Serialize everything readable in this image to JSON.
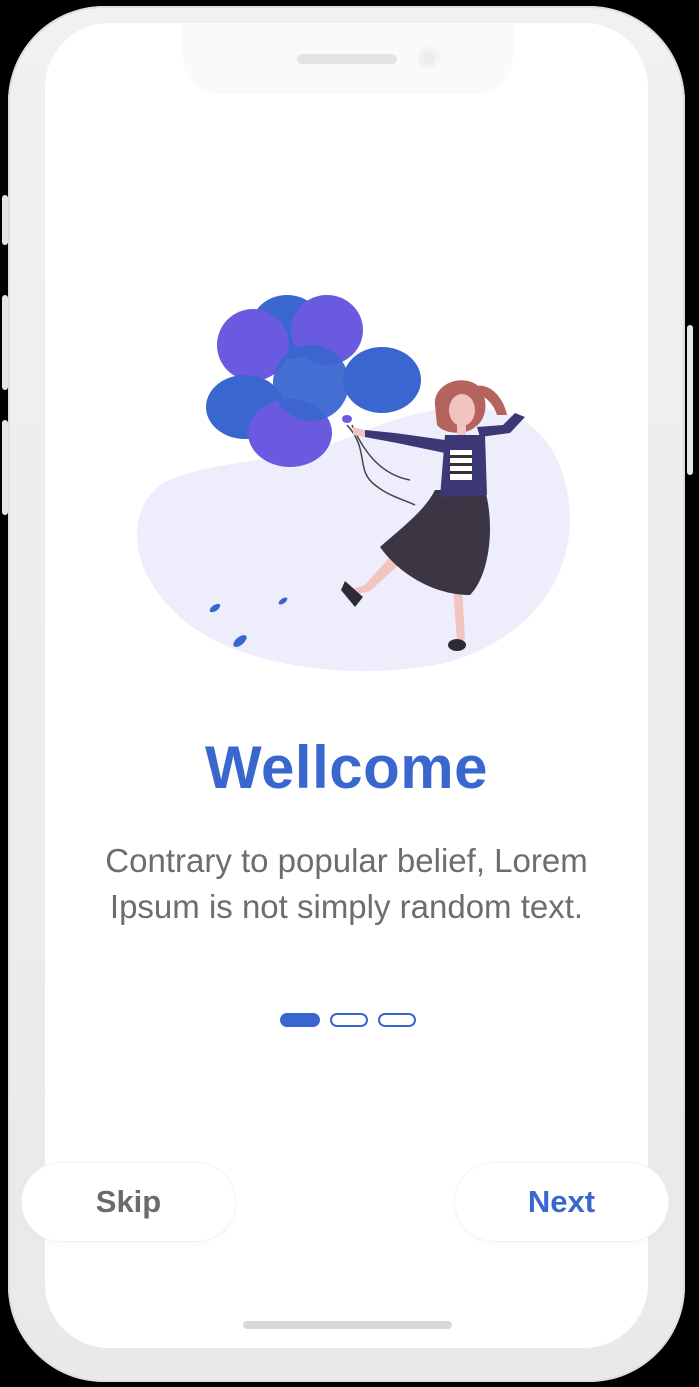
{
  "onboarding": {
    "title": "Wellcome",
    "description": "Contrary to popular belief, Lorem Ipsum is not simply random text.",
    "page_indicator": {
      "total": 3,
      "current": 1
    }
  },
  "actions": {
    "skip_label": "Skip",
    "next_label": "Next"
  },
  "colors": {
    "accent": "#3a66cf",
    "text_muted": "#6d6d6d",
    "balloon_violet": "#6a5ae0",
    "balloon_blue": "#3a66cf",
    "blob": "#eeedfb"
  }
}
